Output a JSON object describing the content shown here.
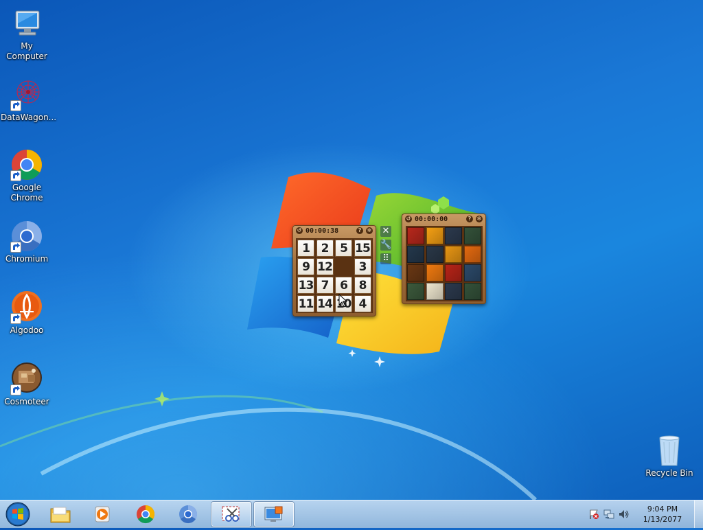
{
  "desktop": {
    "icons": [
      {
        "label": "My Computer"
      },
      {
        "label": "DataWagon..."
      },
      {
        "label": "Google\nChrome"
      },
      {
        "label": "Chromium"
      },
      {
        "label": "Algodoo"
      },
      {
        "label": "Cosmoteer"
      }
    ],
    "recycle_bin": {
      "label": "Recycle Bin"
    }
  },
  "gadgets": {
    "number_puzzle": {
      "timer": "00:00:38",
      "help_icon": "question-icon",
      "options_icon": "settings-icon",
      "tiles": [
        [
          "1",
          "2",
          "5",
          "15"
        ],
        [
          "9",
          "12",
          "",
          "3"
        ],
        [
          "13",
          "7",
          "6",
          "8"
        ],
        [
          "11",
          "14",
          "10",
          "4"
        ]
      ]
    },
    "picture_puzzle": {
      "timer": "00:00:00",
      "tile_colors": [
        [
          "#b8281c",
          "#f5a014",
          "#2c3a4e",
          "#34523a"
        ],
        [
          "#24384c",
          "#2a3848",
          "#e89614",
          "#e46a10"
        ],
        [
          "#6a3814",
          "#f07a10",
          "#b82418",
          "#2c4a6a"
        ],
        [
          "#3c5a3c",
          "#f0e8d0",
          "#2c3a4e",
          "#34523a"
        ]
      ]
    },
    "side_tools": [
      "close-icon",
      "wrench-icon",
      "drag-handle-icon"
    ]
  },
  "taskbar": {
    "items": [
      {
        "name": "windows-explorer"
      },
      {
        "name": "windows-media-player"
      },
      {
        "name": "google-chrome"
      },
      {
        "name": "chromium"
      },
      {
        "name": "snipping-tool"
      },
      {
        "name": "desktop-gadgets"
      }
    ],
    "tray": {
      "icons": [
        "action-center-flag-icon",
        "network-icon",
        "volume-icon"
      ],
      "time": "9:04 PM",
      "date": "1/13/2077"
    }
  }
}
